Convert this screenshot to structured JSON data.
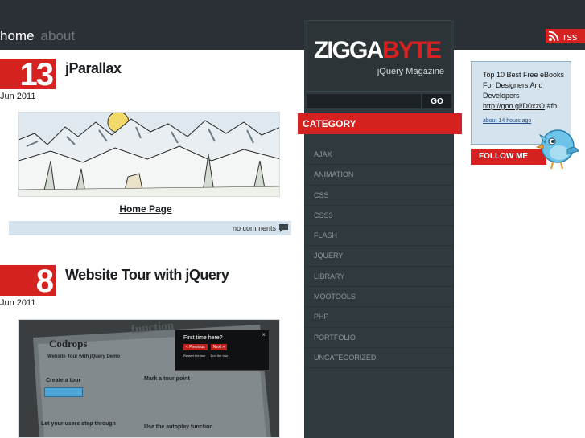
{
  "nav": {
    "home": "home",
    "about": "about"
  },
  "rss": {
    "label": "rss"
  },
  "posts": [
    {
      "day": "13",
      "date": "Jun 2011",
      "title": "jParallax",
      "link": "Home Page",
      "comments": "no comments"
    },
    {
      "day": "8",
      "date": "Jun 2011",
      "title": "Website Tour with jQuery",
      "shot": {
        "heading": "Codrops",
        "subheading": "Website Tour with jQuery Demo",
        "section1": "Create a tour",
        "section2": "Mark a tour point",
        "section3": "Let your users step through",
        "section4": "Use the autoplay function",
        "bg_word": "function",
        "popup_title": "First time here?",
        "popup_prev": "« Previous",
        "popup_next": "Next »",
        "popup_restart": "Restart the tour",
        "popup_end": "End the tour"
      }
    }
  ],
  "sidebar": {
    "logo_white": "ZIGGA",
    "logo_red": "BYTE",
    "logo_sub": "jQuery Magazine",
    "search_placeholder": "",
    "go": "GO",
    "category_title": "CATEGORY",
    "categories": [
      "AJAX",
      "ANIMATION",
      "CSS",
      "CSS3",
      "FLASH",
      "JQUERY",
      "LIBRARY",
      "MOOTOOLS",
      "PHP",
      "PORTFOLIO",
      "UNCATEGORIZED"
    ]
  },
  "twitter": {
    "text": "Top 10 Best Free eBooks For Designers And Developers",
    "link": "http://goo.gl/D0xzO",
    "hashtag": "#fb",
    "time": "about 14 hours ago",
    "follow": "FOLLOW ME"
  },
  "colors": {
    "accent": "#d5211f",
    "topbar": "#2a3035",
    "sidebar": "#2f3a3e",
    "tweet_bg": "#d4e3ed"
  }
}
